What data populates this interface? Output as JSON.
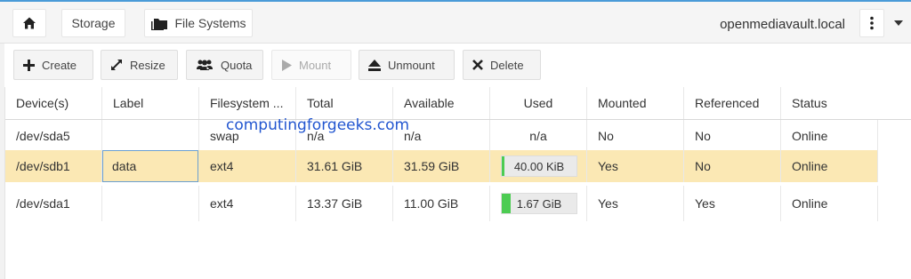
{
  "header": {
    "home_icon": "home-icon",
    "crumbs": [
      {
        "label": "Storage"
      },
      {
        "label": "File Systems",
        "icon": "folder-icon"
      }
    ],
    "hostname": "openmediavault.local",
    "menu_icon": "kebab-menu-icon",
    "dropdown_icon": "caret-down-icon"
  },
  "toolbar": {
    "create": "Create",
    "resize": "Resize",
    "quota": "Quota",
    "mount": "Mount",
    "unmount": "Unmount",
    "delete": "Delete"
  },
  "grid": {
    "columns": [
      "Device(s)",
      "Label",
      "Filesystem ...",
      "Total",
      "Available",
      "Used",
      "Mounted",
      "Referenced",
      "Status"
    ],
    "rows": [
      {
        "device": "/dev/sda5",
        "label": "",
        "fs": "swap",
        "total": "n/a",
        "available": "n/a",
        "used": "n/a",
        "used_fraction": null,
        "mounted": "No",
        "referenced": "No",
        "status": "Online"
      },
      {
        "device": "/dev/sdb1",
        "label": "data",
        "fs": "ext4",
        "total": "31.61 GiB",
        "available": "31.59 GiB",
        "used": "40.00 KiB",
        "used_fraction": 0.01,
        "mounted": "Yes",
        "referenced": "No",
        "status": "Online"
      },
      {
        "device": "/dev/sda1",
        "label": "",
        "fs": "ext4",
        "total": "13.37 GiB",
        "available": "11.00 GiB",
        "used": "1.67 GiB",
        "used_fraction": 0.12,
        "mounted": "Yes",
        "referenced": "Yes",
        "status": "Online"
      }
    ]
  },
  "watermark": "computingforgeeks.com",
  "colors": {
    "accent": "#4a9bd8",
    "selected_row": "#fbe8b4",
    "used_fill": "#4ccc52",
    "watermark": "#2256d0"
  }
}
